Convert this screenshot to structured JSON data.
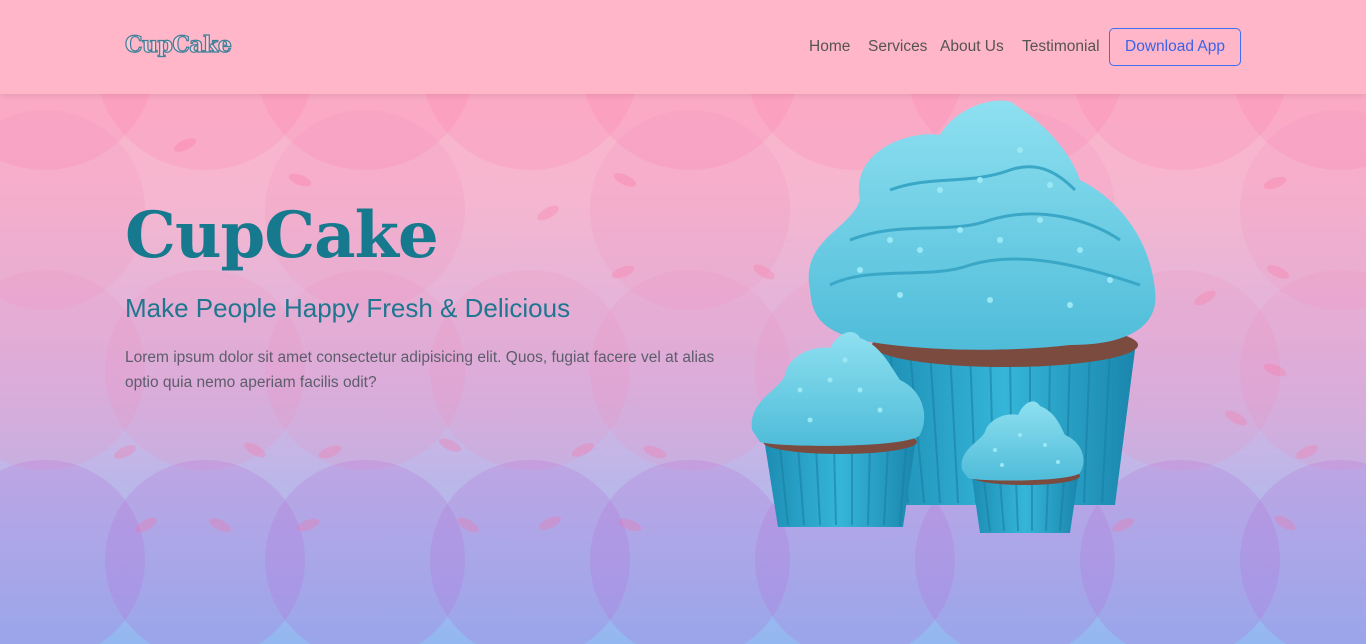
{
  "navbar": {
    "brand": "CupCake",
    "links": [
      "Home",
      "Services",
      "About Us",
      "Testimonial"
    ],
    "cta": "Download App"
  },
  "hero": {
    "title": "CupCake",
    "subtitle": "Make People Happy Fresh & Delicious",
    "description": "Lorem ipsum dolor sit amet consectetur adipisicing elit. Quos, fugiat facere vel at alias optio quia nemo aperiam facilis odit?"
  },
  "colors": {
    "navbar_bg": "#ffb6c8",
    "title": "#17798e",
    "cta_border": "#3f6ef0",
    "frosting": "#6fcde3",
    "liner": "#2aa7cc"
  }
}
